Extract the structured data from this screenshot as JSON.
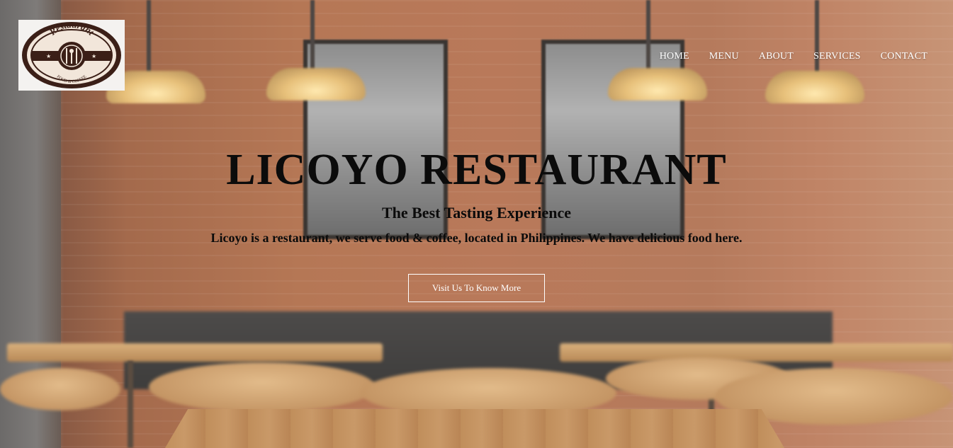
{
  "logo": {
    "arc_text": "Restaurant",
    "tagline": "FOOD & COFFEE"
  },
  "nav": {
    "items": [
      "HOME",
      "MENU",
      "ABOUT",
      "SERVICES",
      "CONTACT"
    ]
  },
  "hero": {
    "title": "LICOYO RESTAURANT",
    "subtitle": "The Best Tasting Experience",
    "description": "Licoyo is a restaurant, we serve food & coffee, located in Philippines. We have delicious food here.",
    "cta_label": "Visit Us To Know More"
  }
}
